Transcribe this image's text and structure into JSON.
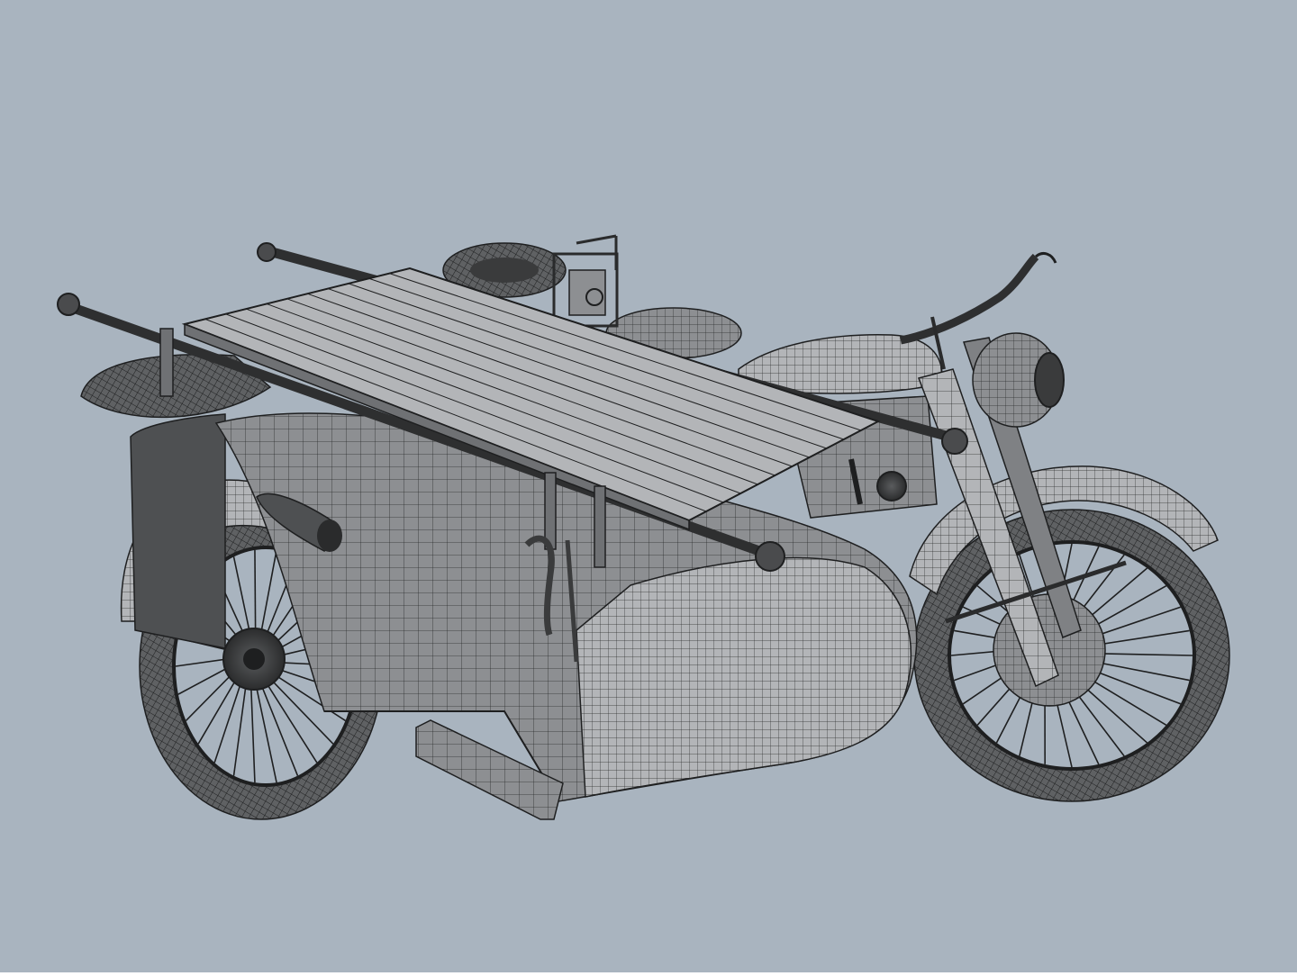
{
  "scene": {
    "background_color": "#a9b4bf",
    "model_fill": "#8d8f92",
    "model_light": "#b3b5b8",
    "model_dark": "#4e5052",
    "wire_color": "#1e1f20",
    "tire_color": "#5f6163"
  }
}
